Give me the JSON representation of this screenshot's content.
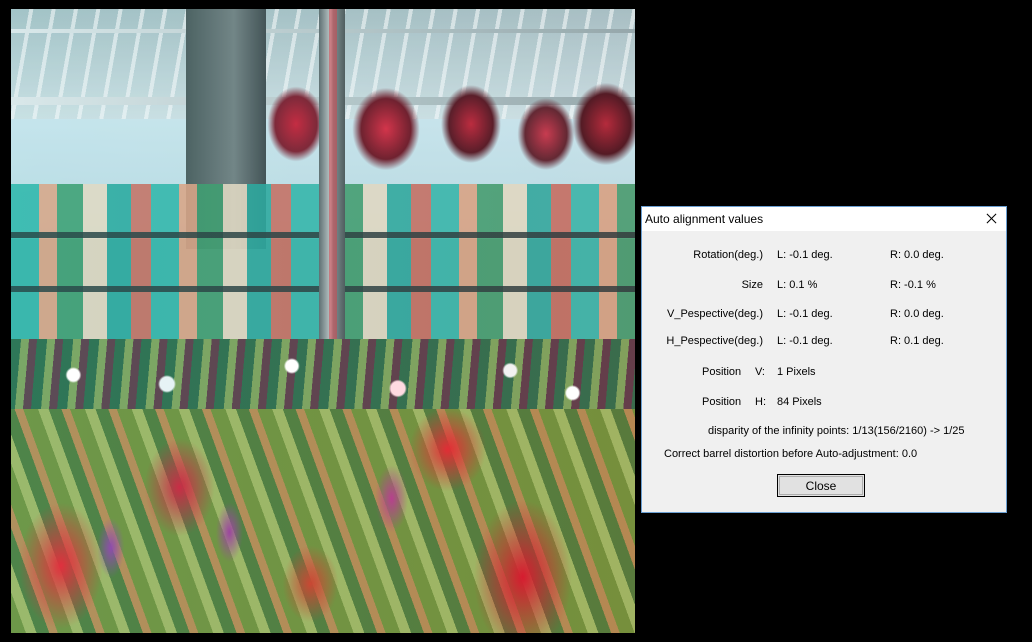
{
  "dialog": {
    "title": "Auto alignment values",
    "rows": [
      {
        "label": "Rotation(deg.)",
        "left": "L:  -0.1 deg.",
        "right": "R:  0.0 deg."
      },
      {
        "label": "Size",
        "left": "L:  0.1 %",
        "right": "R:  -0.1 %"
      },
      {
        "label": "V_Pespective(deg.)",
        "left": "L:  -0.1 deg.",
        "right": "R:  0.0 deg."
      },
      {
        "label": "H_Pespective(deg.)",
        "left": "L:  -0.1 deg.",
        "right": "R:  0.1 deg."
      }
    ],
    "position_v": {
      "label": "Position",
      "axis": "V:",
      "value": "1 Pixels"
    },
    "position_h": {
      "label": "Position",
      "axis": "H:",
      "value": "84 Pixels"
    },
    "disparity": "disparity of the infinity points: 1/13(156/2160) -> 1/25",
    "barrel": "Correct barrel distortion before Auto-adjustment: 0.0",
    "close_label": "Close"
  },
  "photo": {
    "description_icon": "anaglyph-greenhouse-flowers"
  }
}
